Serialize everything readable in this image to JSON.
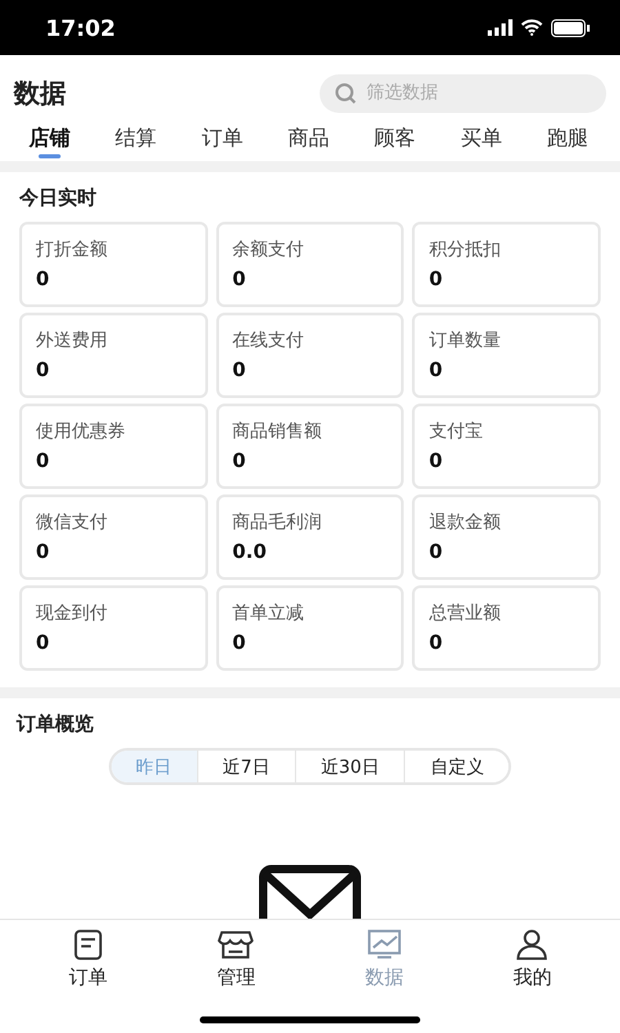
{
  "status_bar": {
    "time": "17:02"
  },
  "header": {
    "title": "数据",
    "search": {
      "placeholder": "筛选数据"
    }
  },
  "tabs": [
    {
      "label": "店铺",
      "selected": true
    },
    {
      "label": "结算",
      "selected": false
    },
    {
      "label": "订单",
      "selected": false
    },
    {
      "label": "商品",
      "selected": false
    },
    {
      "label": "顾客",
      "selected": false
    },
    {
      "label": "买单",
      "selected": false
    },
    {
      "label": "跑腿",
      "selected": false
    }
  ],
  "realtime": {
    "title": "今日实时",
    "cards": [
      {
        "label": "打折金额",
        "value": "0"
      },
      {
        "label": "余额支付",
        "value": "0"
      },
      {
        "label": "积分抵扣",
        "value": "0"
      },
      {
        "label": "外送费用",
        "value": "0"
      },
      {
        "label": "在线支付",
        "value": "0"
      },
      {
        "label": "订单数量",
        "value": "0"
      },
      {
        "label": "使用优惠券",
        "value": "0"
      },
      {
        "label": "商品销售额",
        "value": "0"
      },
      {
        "label": "支付宝",
        "value": "0"
      },
      {
        "label": "微信支付",
        "value": "0"
      },
      {
        "label": "商品毛利润",
        "value": "0.0"
      },
      {
        "label": "退款金额",
        "value": "0"
      },
      {
        "label": "现金到付",
        "value": "0"
      },
      {
        "label": "首单立减",
        "value": "0"
      },
      {
        "label": "总营业额",
        "value": "0"
      }
    ]
  },
  "order_overview": {
    "title": "订单概览",
    "periods": [
      {
        "label": "昨日",
        "selected": true
      },
      {
        "label": "近7日",
        "selected": false
      },
      {
        "label": "近30日",
        "selected": false
      },
      {
        "label": "自定义",
        "selected": false
      }
    ]
  },
  "bottom_nav": [
    {
      "label": "订单",
      "kind": "order",
      "selected": false
    },
    {
      "label": "管理",
      "kind": "store",
      "selected": false
    },
    {
      "label": "数据",
      "kind": "chart",
      "selected": true
    },
    {
      "label": "我的",
      "kind": "user",
      "selected": false
    }
  ]
}
